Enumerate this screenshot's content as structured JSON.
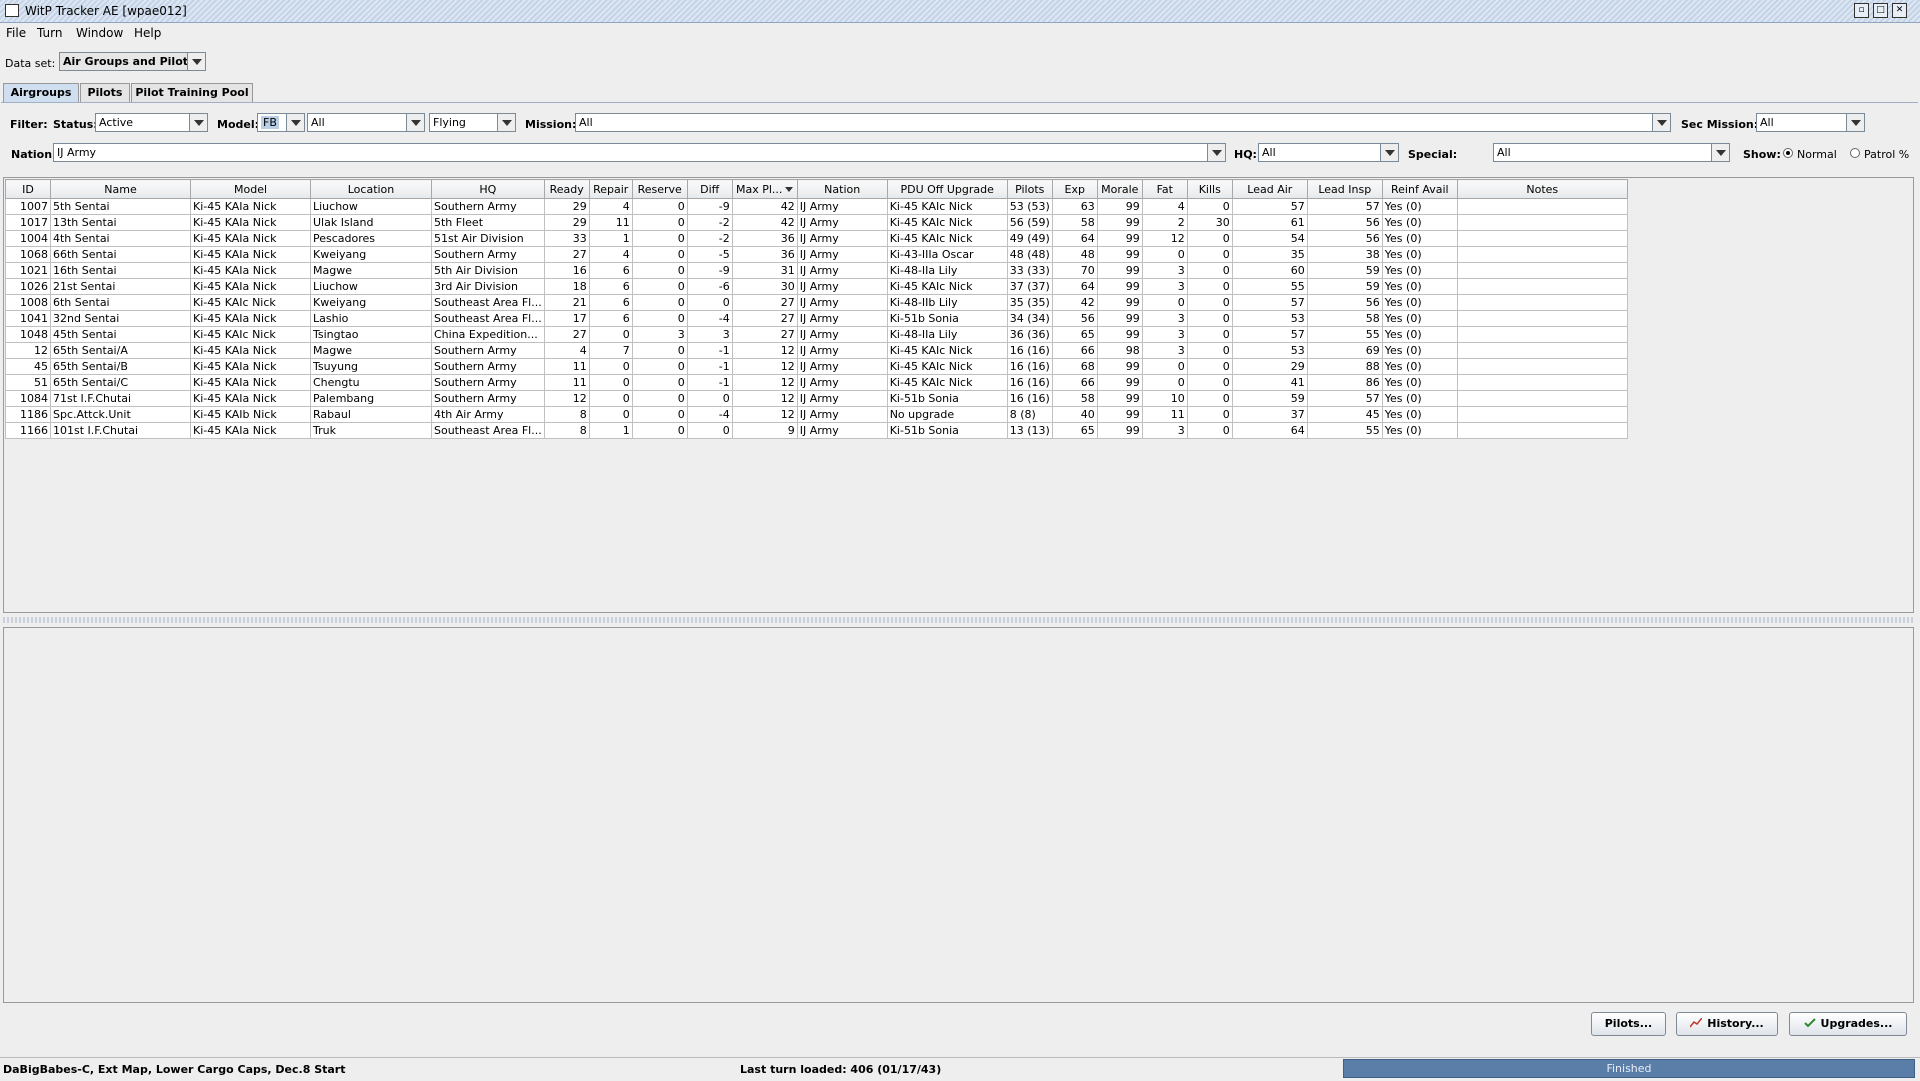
{
  "window": {
    "title": "WitP Tracker AE [wpae012]"
  },
  "menu": [
    "File",
    "Turn",
    "Window",
    "Help"
  ],
  "dataset": {
    "label": "Data set:",
    "value": "Air Groups and Pilots"
  },
  "tabs": [
    "Airgroups",
    "Pilots",
    "Pilot Training Pool"
  ],
  "filter": {
    "label": "Filter:",
    "status_label": "Status:",
    "status_value": "Active",
    "model_label": "Model:",
    "model_type": "FB",
    "model_value": "All",
    "flying_value": "Flying",
    "mission_label": "Mission:",
    "mission_value": "All",
    "sec_mission_label": "Sec Mission:",
    "sec_mission_value": "All",
    "nation_label": "Nation:",
    "nation_value": "IJ Army",
    "hq_label": "HQ:",
    "hq_value": "All",
    "special_label": "Special:",
    "special_value": "All",
    "show_label": "Show:",
    "show_normal": "Normal",
    "show_patrol": "Patrol %"
  },
  "table": {
    "columns": [
      "ID",
      "Name",
      "Model",
      "Location",
      "HQ",
      "Ready",
      "Repair",
      "Reserve",
      "Diff",
      "Max Pl...",
      "Nation",
      "PDU Off Upgrade",
      "Pilots",
      "Exp",
      "Morale",
      "Fat",
      "Kills",
      "Lead Air",
      "Lead Insp",
      "Reinf Avail",
      "Notes"
    ],
    "rows": [
      [
        "1007",
        "5th Sentai",
        "Ki-45 KAIa Nick",
        "Liuchow",
        "Southern Army",
        "29",
        "4",
        "0",
        "-9",
        "42",
        "IJ Army",
        "Ki-45 KAIc Nick",
        "53 (53)",
        "63",
        "99",
        "4",
        "0",
        "57",
        "57",
        "Yes (0)",
        ""
      ],
      [
        "1017",
        "13th Sentai",
        "Ki-45 KAIa Nick",
        "Ulak Island",
        "5th Fleet",
        "29",
        "11",
        "0",
        "-2",
        "42",
        "IJ Army",
        "Ki-45 KAIc Nick",
        "56 (59)",
        "58",
        "99",
        "2",
        "30",
        "61",
        "56",
        "Yes (0)",
        ""
      ],
      [
        "1004",
        "4th Sentai",
        "Ki-45 KAIa Nick",
        "Pescadores",
        "51st Air Division",
        "33",
        "1",
        "0",
        "-2",
        "36",
        "IJ Army",
        "Ki-45 KAIc Nick",
        "49 (49)",
        "64",
        "99",
        "12",
        "0",
        "54",
        "56",
        "Yes (0)",
        ""
      ],
      [
        "1068",
        "66th Sentai",
        "Ki-45 KAIa Nick",
        "Kweiyang",
        "Southern Army",
        "27",
        "4",
        "0",
        "-5",
        "36",
        "IJ Army",
        "Ki-43-IIIa Oscar",
        "48 (48)",
        "48",
        "99",
        "0",
        "0",
        "35",
        "38",
        "Yes (0)",
        ""
      ],
      [
        "1021",
        "16th Sentai",
        "Ki-45 KAIa Nick",
        "Magwe",
        "5th Air Division",
        "16",
        "6",
        "0",
        "-9",
        "31",
        "IJ Army",
        "Ki-48-IIa Lily",
        "33 (33)",
        "70",
        "99",
        "3",
        "0",
        "60",
        "59",
        "Yes (0)",
        ""
      ],
      [
        "1026",
        "21st Sentai",
        "Ki-45 KAIa Nick",
        "Liuchow",
        "3rd Air Division",
        "18",
        "6",
        "0",
        "-6",
        "30",
        "IJ Army",
        "Ki-45 KAIc Nick",
        "37 (37)",
        "64",
        "99",
        "3",
        "0",
        "55",
        "59",
        "Yes (0)",
        ""
      ],
      [
        "1008",
        "6th Sentai",
        "Ki-45 KAIc Nick",
        "Kweiyang",
        "Southeast Area Fl...",
        "21",
        "6",
        "0",
        "0",
        "27",
        "IJ Army",
        "Ki-48-IIb Lily",
        "35 (35)",
        "42",
        "99",
        "0",
        "0",
        "57",
        "56",
        "Yes (0)",
        ""
      ],
      [
        "1041",
        "32nd Sentai",
        "Ki-45 KAIa Nick",
        "Lashio",
        "Southeast Area Fl...",
        "17",
        "6",
        "0",
        "-4",
        "27",
        "IJ Army",
        "Ki-51b Sonia",
        "34 (34)",
        "56",
        "99",
        "3",
        "0",
        "53",
        "58",
        "Yes (0)",
        ""
      ],
      [
        "1048",
        "45th Sentai",
        "Ki-45 KAIc Nick",
        "Tsingtao",
        "China Expedition...",
        "27",
        "0",
        "3",
        "3",
        "27",
        "IJ Army",
        "Ki-48-IIa Lily",
        "36 (36)",
        "65",
        "99",
        "3",
        "0",
        "57",
        "55",
        "Yes (0)",
        ""
      ],
      [
        "12",
        "65th Sentai/A",
        "Ki-45 KAIa Nick",
        "Magwe",
        "Southern Army",
        "4",
        "7",
        "0",
        "-1",
        "12",
        "IJ Army",
        "Ki-45 KAIc Nick",
        "16 (16)",
        "66",
        "98",
        "3",
        "0",
        "53",
        "69",
        "Yes (0)",
        ""
      ],
      [
        "45",
        "65th Sentai/B",
        "Ki-45 KAIa Nick",
        "Tsuyung",
        "Southern Army",
        "11",
        "0",
        "0",
        "-1",
        "12",
        "IJ Army",
        "Ki-45 KAIc Nick",
        "16 (16)",
        "68",
        "99",
        "0",
        "0",
        "29",
        "88",
        "Yes (0)",
        ""
      ],
      [
        "51",
        "65th Sentai/C",
        "Ki-45 KAIa Nick",
        "Chengtu",
        "Southern Army",
        "11",
        "0",
        "0",
        "-1",
        "12",
        "IJ Army",
        "Ki-45 KAIc Nick",
        "16 (16)",
        "66",
        "99",
        "0",
        "0",
        "41",
        "86",
        "Yes (0)",
        ""
      ],
      [
        "1084",
        "71st I.F.Chutai",
        "Ki-45 KAIa Nick",
        "Palembang",
        "Southern Army",
        "12",
        "0",
        "0",
        "0",
        "12",
        "IJ Army",
        "Ki-51b Sonia",
        "16 (16)",
        "58",
        "99",
        "10",
        "0",
        "59",
        "57",
        "Yes (0)",
        ""
      ],
      [
        "1186",
        "Spc.Attck.Unit",
        "Ki-45 KAIb Nick",
        "Rabaul",
        "4th Air Army",
        "8",
        "0",
        "0",
        "-4",
        "12",
        "IJ Army",
        "No upgrade",
        "8 (8)",
        "40",
        "99",
        "11",
        "0",
        "37",
        "45",
        "Yes (0)",
        ""
      ],
      [
        "1166",
        "101st I.F.Chutai",
        "Ki-45 KAIa Nick",
        "Truk",
        "Southeast Area Fl...",
        "8",
        "1",
        "0",
        "0",
        "9",
        "IJ Army",
        "Ki-51b Sonia",
        "13 (13)",
        "65",
        "99",
        "3",
        "0",
        "64",
        "55",
        "Yes (0)",
        ""
      ]
    ]
  },
  "buttons": {
    "pilots": "Pilots...",
    "history": "History...",
    "upgrades": "Upgrades..."
  },
  "status": {
    "scenario": "DaBigBabes-C, Ext Map, Lower Cargo Caps, Dec.8 Start",
    "last_turn": "Last turn loaded: 406 (01/17/43)",
    "progress_text": "Finished",
    "progress_value": 1.0
  },
  "colors": {
    "progress": "#5a7ea8",
    "tab_active": "#cfdff0"
  }
}
